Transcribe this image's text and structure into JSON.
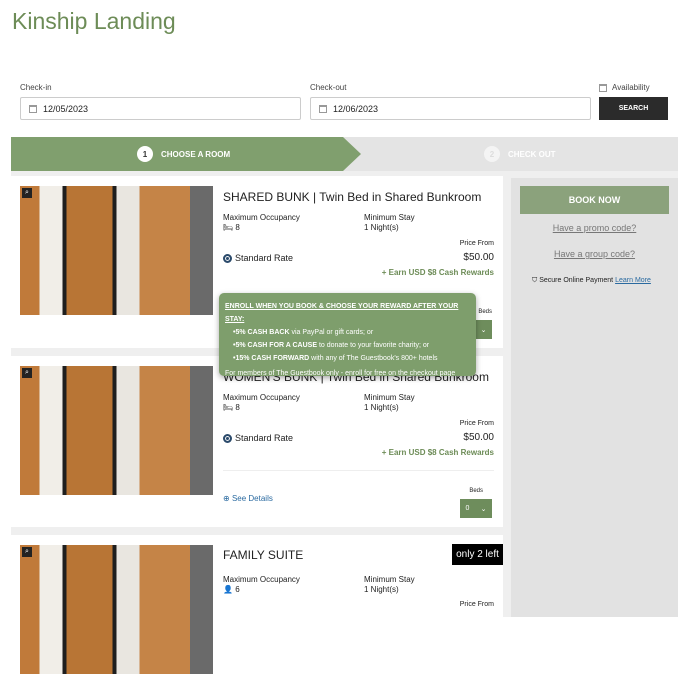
{
  "page": {
    "title": "Kinship Landing"
  },
  "search": {
    "checkin_label": "Check-in",
    "checkin": "12/05/2023",
    "checkout_label": "Check-out",
    "checkout": "12/06/2023",
    "availability": "Availability",
    "button": "SEARCH"
  },
  "steps": [
    {
      "num": "1",
      "label": "CHOOSE A ROOM"
    },
    {
      "num": "2",
      "label": "CHECK OUT"
    }
  ],
  "rooms": [
    {
      "name": "SHARED BUNK | Twin Bed in Shared Bunkroom",
      "occ_label": "Maximum Occupancy",
      "occ": "8",
      "stay_label": "Minimum Stay",
      "stay": "1 Night(s)",
      "price_from": "Price From",
      "rate": "Standard Rate",
      "price": "$50.00",
      "rewards": "+ Earn USD $8 Cash Rewards",
      "beds_label": "Beds",
      "beds": "0"
    },
    {
      "name": "WOMEN'S BUNK | Twin Bed in Shared Bunkroom",
      "occ_label": "Maximum Occupancy",
      "occ": "8",
      "stay_label": "Minimum Stay",
      "stay": "1 Night(s)",
      "price_from": "Price From",
      "rate": "Standard Rate",
      "price": "$50.00",
      "rewards": "+ Earn USD $8 Cash Rewards",
      "details": "See Details",
      "beds_label": "Beds",
      "beds": "0"
    },
    {
      "name": "FAMILY SUITE",
      "badge": "only 2 left",
      "occ_label": "Maximum Occupancy",
      "occ": "6",
      "stay_label": "Minimum Stay",
      "stay": "1 Night(s)",
      "price_from": "Price From"
    }
  ],
  "sidebar": {
    "book": "BOOK NOW",
    "promo": "Have a promo code?",
    "group": "Have a group code?",
    "secure": "Secure Online Payment",
    "learn": "Learn More"
  },
  "tooltip": {
    "heading": "ENROLL WHEN YOU BOOK & CHOOSE YOUR REWARD AFTER YOUR STAY:",
    "items": [
      {
        "b": "•5% CASH BACK",
        "t": " via PayPal or gift cards; or"
      },
      {
        "b": "•5% CASH FOR A CAUSE",
        "t": " to donate to your favorite charity; or"
      },
      {
        "b": "•15% CASH FORWARD",
        "t": " with any of The Guestbook's 800+ hotels"
      }
    ],
    "footer": "For members of The Guestbook only - enroll for free on the checkout page"
  },
  "colors": {
    "brand": "#6d8c57",
    "step_active": "#809f6e",
    "button_dark": "#2b2b2b"
  }
}
